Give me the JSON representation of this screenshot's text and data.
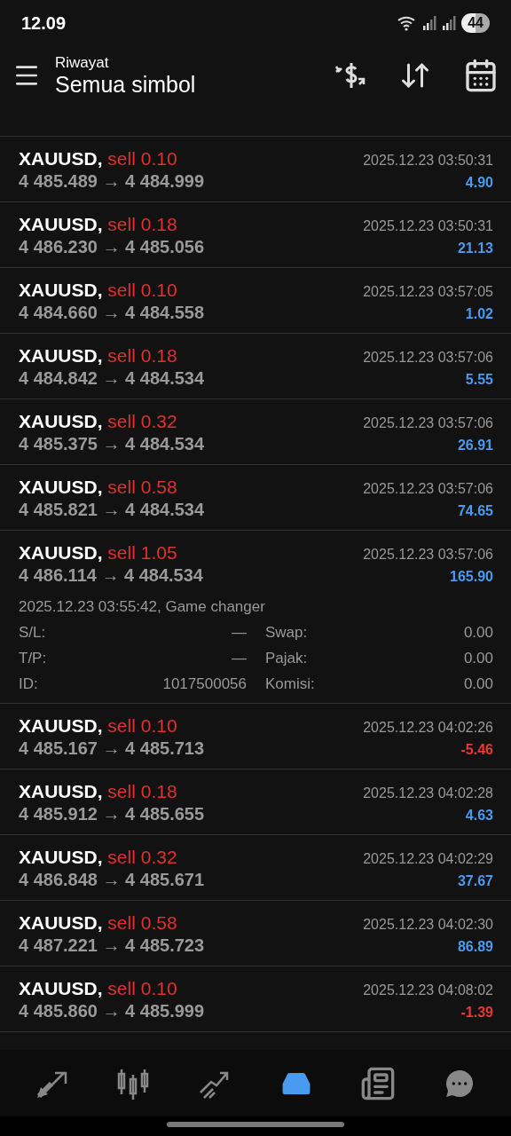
{
  "status_bar": {
    "time": "12.09",
    "battery": "44"
  },
  "header": {
    "subtitle": "Riwayat",
    "title": "Semua simbol"
  },
  "trades": [
    {
      "symbol": "XAUUSD,",
      "order": "sell 0.10",
      "prices": "4 485.489 → 4 484.999",
      "time": "2025.12.23 03:50:31",
      "profit": "4.90",
      "loss": false
    },
    {
      "symbol": "XAUUSD,",
      "order": "sell 0.18",
      "prices": "4 486.230 → 4 485.056",
      "time": "2025.12.23 03:50:31",
      "profit": "21.13",
      "loss": false
    },
    {
      "symbol": "XAUUSD,",
      "order": "sell 0.10",
      "prices": "4 484.660 → 4 484.558",
      "time": "2025.12.23 03:57:05",
      "profit": "1.02",
      "loss": false
    },
    {
      "symbol": "XAUUSD,",
      "order": "sell 0.18",
      "prices": "4 484.842 → 4 484.534",
      "time": "2025.12.23 03:57:06",
      "profit": "5.55",
      "loss": false
    },
    {
      "symbol": "XAUUSD,",
      "order": "sell 0.32",
      "prices": "4 485.375 → 4 484.534",
      "time": "2025.12.23 03:57:06",
      "profit": "26.91",
      "loss": false
    },
    {
      "symbol": "XAUUSD,",
      "order": "sell 0.58",
      "prices": "4 485.821 → 4 484.534",
      "time": "2025.12.23 03:57:06",
      "profit": "74.65",
      "loss": false
    },
    {
      "symbol": "XAUUSD,",
      "order": "sell 1.05",
      "prices": "4 486.114 → 4 484.534",
      "time": "2025.12.23 03:57:06",
      "profit": "165.90",
      "loss": false,
      "details": {
        "opened": "2025.12.23 03:55:42, Game changer",
        "fields": [
          {
            "label": "S/L:",
            "value": "—"
          },
          {
            "label": "Swap:",
            "value": "0.00"
          },
          {
            "label": "T/P:",
            "value": "—"
          },
          {
            "label": "Pajak:",
            "value": "0.00"
          },
          {
            "label": "ID:",
            "value": "1017500056"
          },
          {
            "label": "Komisi:",
            "value": "0.00"
          }
        ]
      }
    },
    {
      "symbol": "XAUUSD,",
      "order": "sell 0.10",
      "prices": "4 485.167 → 4 485.713",
      "time": "2025.12.23 04:02:26",
      "profit": "-5.46",
      "loss": true
    },
    {
      "symbol": "XAUUSD,",
      "order": "sell 0.18",
      "prices": "4 485.912 → 4 485.655",
      "time": "2025.12.23 04:02:28",
      "profit": "4.63",
      "loss": false
    },
    {
      "symbol": "XAUUSD,",
      "order": "sell 0.32",
      "prices": "4 486.848 → 4 485.671",
      "time": "2025.12.23 04:02:29",
      "profit": "37.67",
      "loss": false
    },
    {
      "symbol": "XAUUSD,",
      "order": "sell 0.58",
      "prices": "4 487.221 → 4 485.723",
      "time": "2025.12.23 04:02:30",
      "profit": "86.89",
      "loss": false
    },
    {
      "symbol": "XAUUSD,",
      "order": "sell 0.10",
      "prices": "4 485.860 → 4 485.999",
      "time": "2025.12.23 04:08:02",
      "profit": "-1.39",
      "loss": true
    }
  ],
  "bottom_nav": [
    {
      "kind": "trade",
      "selected": false
    },
    {
      "kind": "quotes",
      "selected": false
    },
    {
      "kind": "chart",
      "selected": false
    },
    {
      "kind": "history",
      "selected": true
    },
    {
      "kind": "news",
      "selected": false
    },
    {
      "kind": "chat",
      "selected": false
    }
  ]
}
